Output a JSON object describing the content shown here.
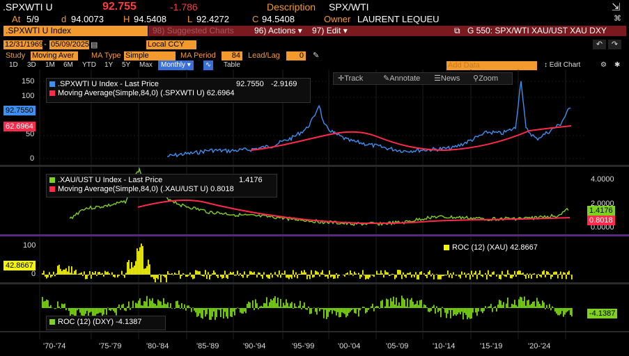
{
  "header": {
    "ticker": ".SPXWTI U",
    "last": "92.755",
    "change": "-1.786",
    "desc_label": "Description",
    "desc_value": "SPX/WTI",
    "at_label": "At",
    "at_value": "5/9",
    "d_label": "d",
    "d_value": "94.0073",
    "h_label": "H",
    "h_value": "94.5408",
    "l_label": "L",
    "l_value": "92.4272",
    "c_label": "C",
    "c_value": "94.5408",
    "owner_label": "Owner",
    "owner_value": "LAURENT LEQUEU"
  },
  "toolbar": {
    "index_name": ".SPXWTI U Index",
    "suggested": "98) Suggested Charts",
    "actions_num": "96)",
    "actions": "Actions",
    "edit_num": "97)",
    "edit": "Edit",
    "chart_title": "G 550: SPX/WTI XAU/UST XAU DXY"
  },
  "settings": {
    "date_from": "12/31/1969",
    "date_to": "05/09/2025",
    "currency": "Local CCY",
    "study_label": "Study",
    "study_value": "Moving Aver",
    "ma_type_label": "MA Type",
    "ma_type_value": "Simple",
    "ma_period_label": "MA Period",
    "ma_period_value": "84",
    "leadlag_label": "Lead/Lag",
    "leadlag_value": "0"
  },
  "ranges": [
    "1D",
    "3D",
    "1M",
    "6M",
    "YTD",
    "1Y",
    "5Y",
    "Max"
  ],
  "frequency": "Monthly",
  "table_label": "Table",
  "add_data": "Add Data",
  "edit_chart": "Edit Chart",
  "tools": {
    "track": "Track",
    "annotate": "Annotate",
    "news": "News",
    "zoom": "Zoom"
  },
  "panel1": {
    "legend1": ".SPXWTI U Index - Last Price",
    "legend1_val": "92.7550",
    "legend1_chg": "-2.9169",
    "legend2": "Moving Average(Simple,84,0) (.SPXWTI U)",
    "legend2_val": "62.6964",
    "tag_last": "92.7550",
    "tag_ma": "62.6964",
    "ticks": [
      "150",
      "100",
      "50",
      "0"
    ],
    "color_last": "#3d8ff0",
    "color_ma": "#ff2a4a"
  },
  "panel2": {
    "legend1": ".XAU/UST U Index - Last Price",
    "legend1_val": "1.4176",
    "legend2": "Moving Average(Simple,84,0) (.XAU/UST U)",
    "legend2_val": "0.8018",
    "tag_last": "1.4176",
    "tag_ma": "0.8018",
    "ticks": [
      "4.0000",
      "2.0000",
      "0.0000"
    ],
    "color_last": "#7fd11f",
    "color_ma": "#ff2a4a"
  },
  "panel3": {
    "legend": "ROC (12) (XAU)",
    "legend_val": "42.8667",
    "tag": "42.8667",
    "ticks": [
      "100",
      "50",
      "0"
    ],
    "color": "#f5f500"
  },
  "panel4": {
    "legend": "ROC (12) (DXY)",
    "legend_val": "-4.1387",
    "tag": "-4.1387",
    "color": "#7fd11f"
  },
  "x_labels": [
    "'70-'74",
    "'75-'79",
    "'80-'84",
    "'85-'89",
    "'90-'94",
    "'95-'99",
    "'00-'04",
    "'05-'09",
    "'10-'14",
    "'15-'19",
    "'20-'24"
  ]
}
